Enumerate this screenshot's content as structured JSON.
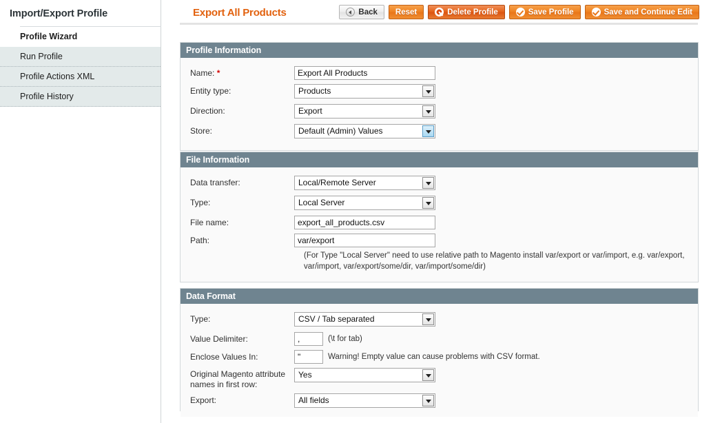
{
  "sidebar": {
    "title": "Import/Export Profile",
    "items": [
      {
        "label": "Profile Wizard",
        "active": true
      },
      {
        "label": "Run Profile",
        "active": false
      },
      {
        "label": "Profile Actions XML",
        "active": false
      },
      {
        "label": "Profile History",
        "active": false
      }
    ]
  },
  "header": {
    "page_title": "Export All Products",
    "buttons": [
      {
        "label": "Back",
        "icon": "back-arrow-circle-icon",
        "style": "grey"
      },
      {
        "label": "Reset",
        "icon": "none",
        "style": "orange"
      },
      {
        "label": "Delete Profile",
        "icon": "cross-circle-icon",
        "style": "delete"
      },
      {
        "label": "Save Profile",
        "icon": "check-circle-icon",
        "style": "orange"
      },
      {
        "label": "Save and Continue Edit",
        "icon": "check-circle-icon",
        "style": "orange"
      }
    ]
  },
  "profile_information": {
    "section_title": "Profile Information",
    "name_label": "Name:",
    "name_required": "*",
    "name_value": "Export All Products",
    "entity_type_label": "Entity type:",
    "entity_type_value": "Products",
    "direction_label": "Direction:",
    "direction_value": "Export",
    "store_label": "Store:",
    "store_value": "Default (Admin) Values"
  },
  "file_information": {
    "section_title": "File Information",
    "data_transfer_label": "Data transfer:",
    "data_transfer_value": "Local/Remote Server",
    "type_label": "Type:",
    "type_value": "Local Server",
    "file_name_label": "File name:",
    "file_name_value": "export_all_products.csv",
    "path_label": "Path:",
    "path_value": "var/export",
    "path_note": "(For Type \"Local Server\" need to use relative path to Magento install var/export or var/import, e.g. var/export, var/import, var/export/some/dir, var/import/some/dir)"
  },
  "data_format": {
    "section_title": "Data Format",
    "type_label": "Type:",
    "type_value": "CSV / Tab separated",
    "value_delimiter_label": "Value Delimiter:",
    "value_delimiter_value": ",",
    "value_delimiter_hint": "(\\t for tab)",
    "enclose_label": "Enclose Values In:",
    "enclose_value": "\"",
    "enclose_hint": "Warning! Empty value can cause problems with CSV format.",
    "original_names_label": "Original Magento attribute names in first row:",
    "original_names_value": "Yes",
    "export_label": "Export:",
    "export_value": "All fields"
  },
  "colors": {
    "accent_orange": "#e2620f",
    "section_header": "#6f8490",
    "required_red": "#d40707",
    "sidebar_item_bg": "#e3eaea",
    "panel_bg": "#fafafa"
  }
}
